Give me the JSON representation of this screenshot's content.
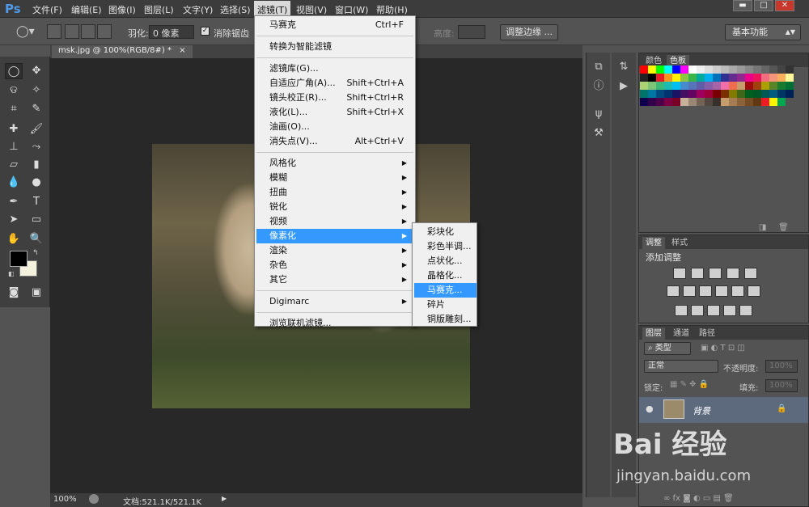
{
  "app": {
    "logo": "Ps"
  },
  "menubar": {
    "items": [
      "文件(F)",
      "编辑(E)",
      "图像(I)",
      "图层(L)",
      "文字(Y)",
      "选择(S)",
      "滤镜(T)",
      "视图(V)",
      "窗口(W)",
      "帮助(H)"
    ],
    "active": "滤镜(T)"
  },
  "window_controls": {
    "minimize": "▬",
    "maximize": "□",
    "close": "✕"
  },
  "options": {
    "feather_label": "羽化:",
    "feather_value": "0 像素",
    "antialias_label": "消除锯齿",
    "height_label": "高度:",
    "refine_edge": "调整边缘 ...",
    "workspace": "基本功能"
  },
  "document": {
    "tab": "msk.jpg @ 100%(RGB/8#) *",
    "zoom": "100%",
    "doc_info": "文档:521.1K/521.1K"
  },
  "filter_menu": {
    "items": [
      {
        "label": "马赛克",
        "shortcut": "Ctrl+F"
      },
      {
        "sep": true
      },
      {
        "label": "转换为智能滤镜"
      },
      {
        "sep": true
      },
      {
        "label": "滤镜库(G)..."
      },
      {
        "label": "自适应广角(A)...",
        "shortcut": "Shift+Ctrl+A"
      },
      {
        "label": "镜头校正(R)...",
        "shortcut": "Shift+Ctrl+R"
      },
      {
        "label": "液化(L)...",
        "shortcut": "Shift+Ctrl+X"
      },
      {
        "label": "油画(O)..."
      },
      {
        "label": "消失点(V)...",
        "shortcut": "Alt+Ctrl+V"
      },
      {
        "sep": true
      },
      {
        "label": "风格化",
        "submenu": true
      },
      {
        "label": "模糊",
        "submenu": true
      },
      {
        "label": "扭曲",
        "submenu": true
      },
      {
        "label": "锐化",
        "submenu": true
      },
      {
        "label": "视频",
        "submenu": true
      },
      {
        "label": "像素化",
        "submenu": true,
        "highlight": true
      },
      {
        "label": "渲染",
        "submenu": true
      },
      {
        "label": "杂色",
        "submenu": true
      },
      {
        "label": "其它",
        "submenu": true
      },
      {
        "sep": true
      },
      {
        "label": "Digimarc",
        "submenu": true
      },
      {
        "sep": true
      },
      {
        "label": "浏览联机滤镜..."
      }
    ]
  },
  "pixelate_submenu": {
    "items": [
      {
        "label": "彩块化"
      },
      {
        "label": "彩色半调..."
      },
      {
        "label": "点状化..."
      },
      {
        "label": "晶格化..."
      },
      {
        "label": "马赛克...",
        "highlight": true
      },
      {
        "label": "碎片"
      },
      {
        "label": "铜版雕刻..."
      }
    ]
  },
  "swatches_panel": {
    "tabs": [
      "颜色",
      "色板"
    ],
    "colors": [
      "#ff0000",
      "#ffff00",
      "#00ff00",
      "#00ffff",
      "#0000ff",
      "#ff00ff",
      "#ffffff",
      "#eeeeee",
      "#dddddd",
      "#cccccc",
      "#bbbbbb",
      "#aaaaaa",
      "#999999",
      "#888888",
      "#777777",
      "#666666",
      "#555555",
      "#444444",
      "#333333",
      "#222222",
      "#000000",
      "#ed1c24",
      "#f7941d",
      "#fff200",
      "#8dc63f",
      "#39b54a",
      "#00a99d",
      "#00aeef",
      "#0072bc",
      "#2e3192",
      "#662d91",
      "#92278f",
      "#ec008c",
      "#ed145b",
      "#f26d7d",
      "#f69679",
      "#fbaf5d",
      "#fff799",
      "#acd373",
      "#7cc576",
      "#3cb878",
      "#1cbbb4",
      "#00bff3",
      "#448ccb",
      "#5674b9",
      "#605ca8",
      "#8560a8",
      "#a864a8",
      "#f06eaa",
      "#f26c4f",
      "#c69c6d",
      "#9e0b0f",
      "#a0410d",
      "#aba000",
      "#598527",
      "#197b30",
      "#007236",
      "#00746b",
      "#0076a3",
      "#004a80",
      "#003471",
      "#1b1464",
      "#440e62",
      "#630460",
      "#9e005d",
      "#9e0039",
      "#790000",
      "#7b2e00",
      "#827b00",
      "#406618",
      "#005e20",
      "#005826",
      "#005952",
      "#005b7f",
      "#003663",
      "#002157",
      "#0d004c",
      "#32004b",
      "#4b0049",
      "#7b0046",
      "#7a0026",
      "#c7b299",
      "#998675",
      "#736357",
      "#534741",
      "#37302a",
      "#c69c6d",
      "#a67c52",
      "#8c6239",
      "#754c24",
      "#603913",
      "#ed1c24",
      "#fff200",
      "#00a651"
    ]
  },
  "adjustments_panel": {
    "tabs": [
      "调整",
      "样式"
    ],
    "title": "添加调整"
  },
  "layers_panel": {
    "tabs": [
      "图层",
      "通道",
      "路径"
    ],
    "kind": "类型",
    "blend_mode": "正常",
    "opacity_label": "不透明度:",
    "opacity_value": "100%",
    "lock_label": "锁定:",
    "fill_label": "填充:",
    "fill_value": "100%",
    "layer_name": "背景"
  },
  "watermark": {
    "logo": "Bai 经验",
    "url": "jingyan.baidu.com"
  }
}
